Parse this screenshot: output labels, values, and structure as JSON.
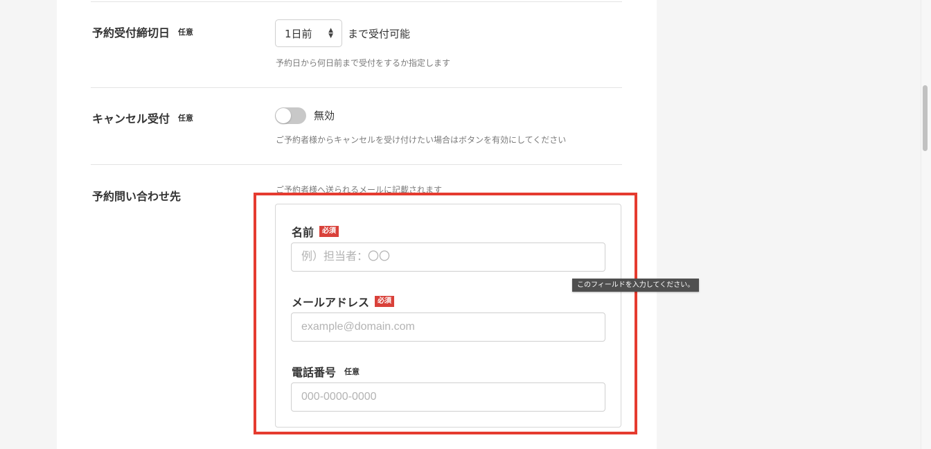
{
  "deadline": {
    "label": "予約受付締切日",
    "badge": "任意",
    "select_value": "1日前",
    "suffix": "まで受付可能",
    "help": "予約日から何日前まで受付をするか指定します"
  },
  "cancel": {
    "label": "キャンセル受付",
    "badge": "任意",
    "toggle_state": "無効",
    "toggle_on": false,
    "help": "ご予約者様からキャンセルを受け付けたい場合はボタンを有効にしてください"
  },
  "contact": {
    "label": "予約問い合わせ先",
    "help": "ご予約者様へ送られるメールに記載されます",
    "fields": {
      "name": {
        "label": "名前",
        "badge": "必須",
        "placeholder": "例）担当者：〇〇"
      },
      "email": {
        "label": "メールアドレス",
        "badge": "必須",
        "placeholder": "example@domain.com"
      },
      "phone": {
        "label": "電話番号",
        "badge": "任意",
        "placeholder": "000-0000-0000"
      }
    }
  },
  "tooltip": "このフィールドを入力してください。",
  "colors": {
    "highlight": "#e53b2f",
    "required_badge": "#d9413a",
    "toggle_off": "#c8c8c8"
  }
}
